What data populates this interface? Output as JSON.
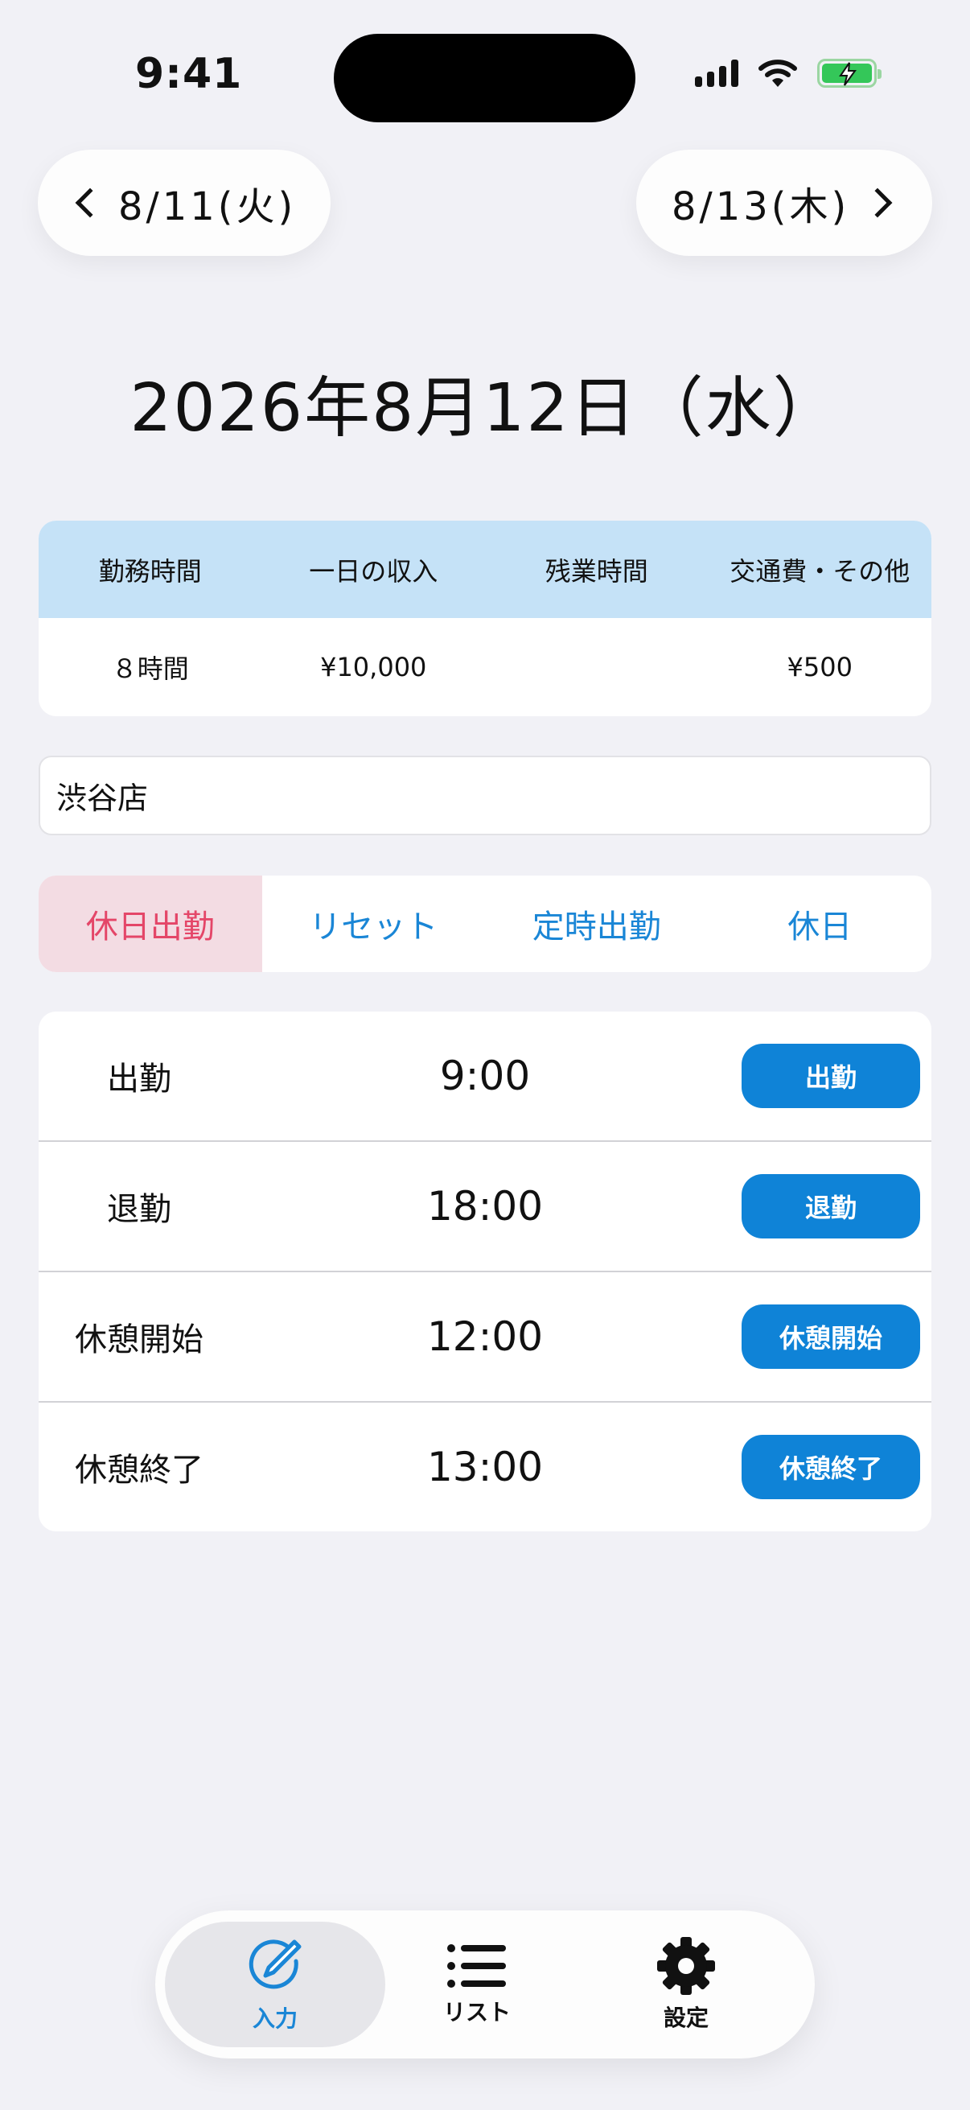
{
  "status": {
    "time": "9:41"
  },
  "nav": {
    "prev_label": "8/11(火)",
    "next_label": "8/13(木)"
  },
  "date_title": "2026年8月12日（水）",
  "summary": {
    "headers": [
      "勤務時間",
      "一日の収入",
      "残業時間",
      "交通費・その他"
    ],
    "values": [
      "８時間",
      "¥10,000",
      "",
      "¥500"
    ]
  },
  "store": {
    "value": "渋谷店"
  },
  "modes": [
    "休日出勤",
    "リセット",
    "定時出勤",
    "休日"
  ],
  "records": [
    {
      "label": "出勤",
      "time": "9:00",
      "button": "出勤"
    },
    {
      "label": "退勤",
      "time": "18:00",
      "button": "退勤"
    },
    {
      "label": "休憩開始",
      "time": "12:00",
      "button": "休憩開始"
    },
    {
      "label": "休憩終了",
      "time": "13:00",
      "button": "休憩終了"
    }
  ],
  "tabs": [
    {
      "label": "入力",
      "icon": "pencil-circle-icon"
    },
    {
      "label": "リスト",
      "icon": "list-icon"
    },
    {
      "label": "設定",
      "icon": "gear-icon"
    }
  ],
  "colors": {
    "accent": "#1a86d6",
    "header_bg": "#c5e2f7",
    "active_mode_bg": "#f3dce3",
    "active_mode_text": "#e44668",
    "button_bg": "#0f83d7"
  }
}
